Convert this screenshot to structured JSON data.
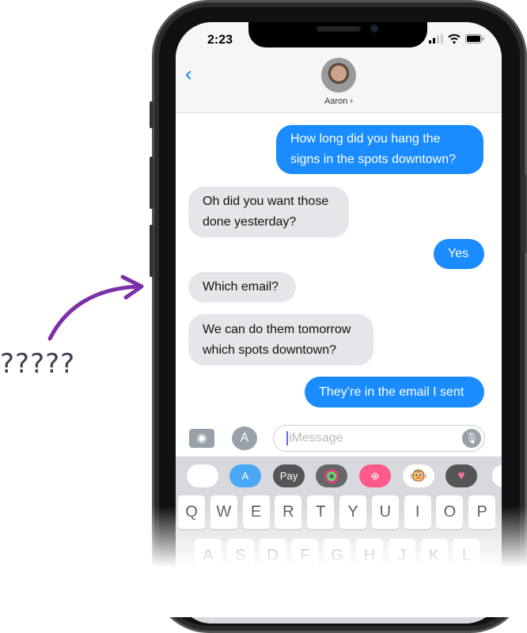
{
  "status": {
    "time": "2:23"
  },
  "contact": {
    "name": "Aaron ›"
  },
  "messages": [
    {
      "from": "me",
      "text": "How long did you hang the signs in the spots downtown?"
    },
    {
      "from": "them",
      "text": "Oh did you want those done yesterday?"
    },
    {
      "from": "me",
      "text": "Yes"
    },
    {
      "from": "them",
      "text": "Which email?"
    },
    {
      "from": "them",
      "text": "We can do them tomorrow which spots downtown?"
    },
    {
      "from": "me",
      "text": "They’re in the email I sent"
    }
  ],
  "input": {
    "placeholder": "iMessage"
  },
  "apps": [
    "photos",
    "app-store",
    "apple-pay",
    "activity",
    "web-search",
    "animoji",
    "digital-touch"
  ],
  "apple_pay_label": " Pay",
  "keys_row1": [
    "Q",
    "W",
    "E",
    "R",
    "T",
    "Y",
    "U",
    "I",
    "O",
    "P"
  ],
  "keys_row2": [
    "A",
    "S",
    "D",
    "F",
    "G",
    "H",
    "J",
    "K",
    "L"
  ],
  "annotation": "?????",
  "colors": {
    "sent": "#1a8cff",
    "received": "#e5e5ea",
    "arrow": "#7b2fa8"
  }
}
